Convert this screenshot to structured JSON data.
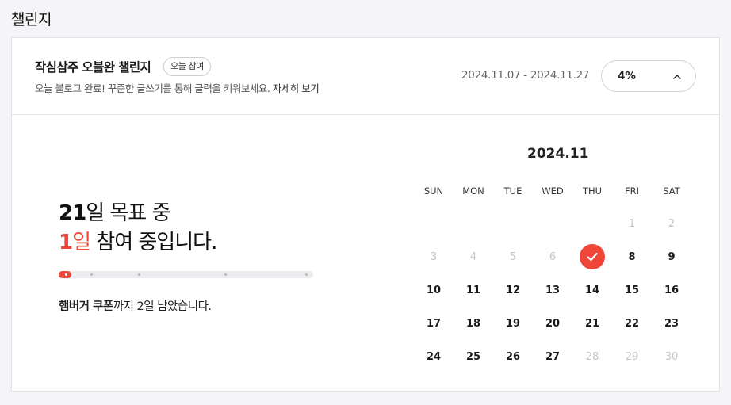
{
  "page": {
    "title": "챌린지"
  },
  "challenge": {
    "title": "작심삼주 오블완 챌린지",
    "badge": "오늘 참여",
    "desc_prefix": "오늘 블로그 완료! 꾸준한 글쓰기를 통해 글력을 키워보세요.",
    "detail_link": "자세히 보기",
    "date_range": "2024.11.07 - 2024.11.27",
    "progress_label": "4%",
    "progress_icon": "chevron-up-icon"
  },
  "status": {
    "goal_days": "21",
    "goal_suffix": "일 목표 중",
    "joined_days": "1",
    "joined_unit": "일",
    "joined_suffix": " 참여 중입니다.",
    "progress_fraction": 0.04,
    "milestones": [
      0.125,
      0.31,
      0.65,
      0.97
    ],
    "reward_name": "햄버거 쿠폰",
    "reward_suffix": "까지 2일 남았습니다."
  },
  "calendar": {
    "month_label": "2024.11",
    "weekdays": [
      "SUN",
      "MON",
      "TUE",
      "WED",
      "THU",
      "FRI",
      "SAT"
    ],
    "weeks": [
      [
        null,
        null,
        null,
        null,
        null,
        "1",
        "2"
      ],
      [
        "3",
        "4",
        "5",
        "6",
        "7",
        "8",
        "9"
      ],
      [
        "10",
        "11",
        "12",
        "13",
        "14",
        "15",
        "16"
      ],
      [
        "17",
        "18",
        "19",
        "20",
        "21",
        "22",
        "23"
      ],
      [
        "24",
        "25",
        "26",
        "27",
        "28",
        "29",
        "30"
      ]
    ],
    "muted_days": [
      "1",
      "2",
      "3",
      "4",
      "5",
      "6",
      "28",
      "29",
      "30"
    ],
    "checked_days": [
      "7"
    ],
    "accent_color": "#f0463a",
    "check_icon": "check-icon"
  }
}
